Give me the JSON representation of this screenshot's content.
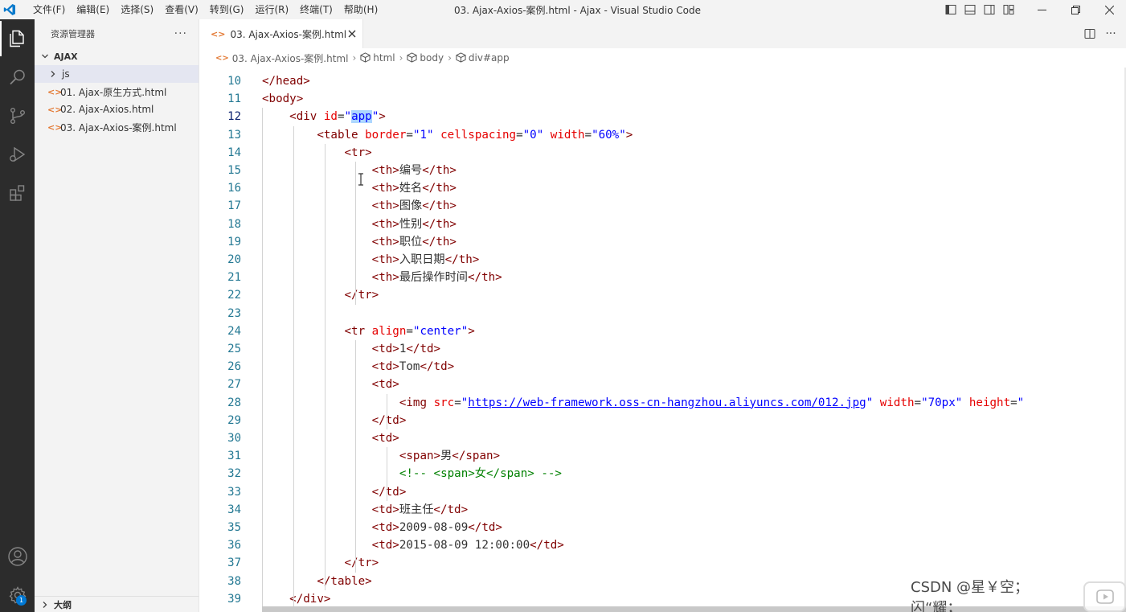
{
  "titlebar": {
    "menu": [
      "文件(F)",
      "编辑(E)",
      "选择(S)",
      "查看(V)",
      "转到(G)",
      "运行(R)",
      "终端(T)",
      "帮助(H)"
    ],
    "title": "03. Ajax-Axios-案例.html - Ajax - Visual Studio Code"
  },
  "sidebar": {
    "header": "资源管理器",
    "more": "···",
    "folder": "AJAX",
    "items": [
      {
        "label": "js",
        "type": "folder"
      },
      {
        "label": "01. Ajax-原生方式.html",
        "type": "html"
      },
      {
        "label": "02. Ajax-Axios.html",
        "type": "html"
      },
      {
        "label": "03. Ajax-Axios-案例.html",
        "type": "html"
      }
    ],
    "outline": "大纲",
    "badge_count": "1"
  },
  "tab": {
    "label": "03. Ajax-Axios-案例.html",
    "icon": "<>"
  },
  "breadcrumb": {
    "file": "03. Ajax-Axios-案例.html",
    "items": [
      "html",
      "body",
      "div#app"
    ]
  },
  "editor": {
    "current_line": 12,
    "lines": [
      {
        "n": "10",
        "html": "<span class='t'>&lt;/head&gt;</span>"
      },
      {
        "n": "11",
        "html": "<span class='t'>&lt;body&gt;</span>"
      },
      {
        "n": "12",
        "html": "    <span class='t'>&lt;div</span> <span class='a'>id</span><span class='x'>=</span><span class='v'>\"<span class='hl'>app</span>\"</span><span class='t'>&gt;</span>"
      },
      {
        "n": "13",
        "html": "        <span class='t'>&lt;table</span> <span class='a'>border</span><span class='x'>=</span><span class='v'>\"1\"</span> <span class='a'>cellspacing</span><span class='x'>=</span><span class='v'>\"0\"</span> <span class='a'>width</span><span class='x'>=</span><span class='v'>\"60%\"</span><span class='t'>&gt;</span>"
      },
      {
        "n": "14",
        "html": "            <span class='t'>&lt;tr&gt;</span>"
      },
      {
        "n": "15",
        "html": "                <span class='t'>&lt;th&gt;</span>编号<span class='t'>&lt;/th&gt;</span>"
      },
      {
        "n": "16",
        "html": "                <span class='t'>&lt;th&gt;</span>姓名<span class='t'>&lt;/th&gt;</span>"
      },
      {
        "n": "17",
        "html": "                <span class='t'>&lt;th&gt;</span>图像<span class='t'>&lt;/th&gt;</span>"
      },
      {
        "n": "18",
        "html": "                <span class='t'>&lt;th&gt;</span>性别<span class='t'>&lt;/th&gt;</span>"
      },
      {
        "n": "19",
        "html": "                <span class='t'>&lt;th&gt;</span>职位<span class='t'>&lt;/th&gt;</span>"
      },
      {
        "n": "20",
        "html": "                <span class='t'>&lt;th&gt;</span>入职日期<span class='t'>&lt;/th&gt;</span>"
      },
      {
        "n": "21",
        "html": "                <span class='t'>&lt;th&gt;</span>最后操作时间<span class='t'>&lt;/th&gt;</span>"
      },
      {
        "n": "22",
        "html": "            <span class='t'>&lt;/tr&gt;</span>"
      },
      {
        "n": "23",
        "html": ""
      },
      {
        "n": "24",
        "html": "            <span class='t'>&lt;tr</span> <span class='a'>align</span><span class='x'>=</span><span class='v'>\"center\"</span><span class='t'>&gt;</span>"
      },
      {
        "n": "25",
        "html": "                <span class='t'>&lt;td&gt;</span>1<span class='t'>&lt;/td&gt;</span>"
      },
      {
        "n": "26",
        "html": "                <span class='t'>&lt;td&gt;</span>Tom<span class='t'>&lt;/td&gt;</span>"
      },
      {
        "n": "27",
        "html": "                <span class='t'>&lt;td&gt;</span>"
      },
      {
        "n": "28",
        "html": "                    <span class='t'>&lt;img</span> <span class='a'>src</span><span class='x'>=</span><span class='v'>\"</span><span class='u'>https://web-framework.oss-cn-hangzhou.aliyuncs.com/012.jpg</span><span class='v'>\"</span> <span class='a'>width</span><span class='x'>=</span><span class='v'>\"70px\"</span> <span class='a'>height</span><span class='x'>=</span><span class='v'>\"</span>"
      },
      {
        "n": "29",
        "html": "                <span class='t'>&lt;/td&gt;</span>"
      },
      {
        "n": "30",
        "html": "                <span class='t'>&lt;td&gt;</span>"
      },
      {
        "n": "31",
        "html": "                    <span class='t'>&lt;span&gt;</span>男<span class='t'>&lt;/span&gt;</span>"
      },
      {
        "n": "32",
        "html": "                    <span class='c'>&lt;!-- &lt;span&gt;女&lt;/span&gt; --&gt;</span>"
      },
      {
        "n": "33",
        "html": "                <span class='t'>&lt;/td&gt;</span>"
      },
      {
        "n": "34",
        "html": "                <span class='t'>&lt;td&gt;</span>班主任<span class='t'>&lt;/td&gt;</span>"
      },
      {
        "n": "35",
        "html": "                <span class='t'>&lt;td&gt;</span>2009-08-09<span class='t'>&lt;/td&gt;</span>"
      },
      {
        "n": "36",
        "html": "                <span class='t'>&lt;td&gt;</span>2015-08-09 12:00:00<span class='t'>&lt;/td&gt;</span>"
      },
      {
        "n": "37",
        "html": "            <span class='t'>&lt;/tr&gt;</span>"
      },
      {
        "n": "38",
        "html": "        <span class='t'>&lt;/table&gt;</span>"
      },
      {
        "n": "39",
        "html": "    <span class='t'>&lt;/div&gt;</span>"
      }
    ]
  },
  "watermark": "CSDN @星￥空；闪“耀；"
}
